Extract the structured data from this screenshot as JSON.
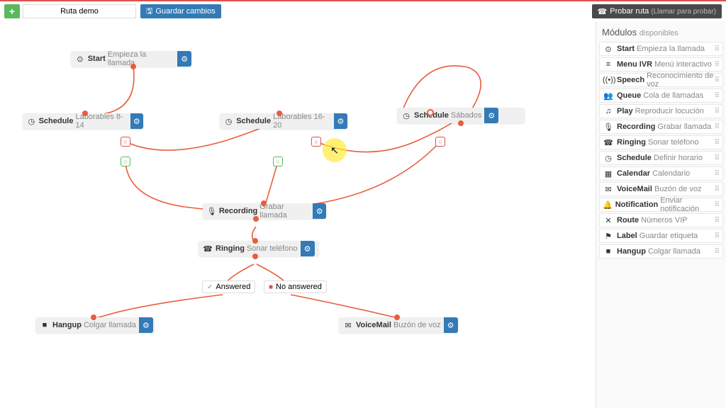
{
  "topbar": {
    "route_name": "Ruta demo",
    "save_label": "Guardar cambios",
    "test_label": "Probar ruta",
    "test_sub": "(Llamar para probar)"
  },
  "sidebar": {
    "title": "Módulos",
    "title_sub": "disponibles",
    "modules": [
      {
        "icon": "⊙",
        "name": "Start",
        "desc": "Empieza la llamada"
      },
      {
        "icon": "≡",
        "name": "Menu IVR",
        "desc": "Menú interactivo"
      },
      {
        "icon": "((•))",
        "name": "Speech",
        "desc": "Reconocimiento de voz"
      },
      {
        "icon": "👥",
        "name": "Queue",
        "desc": "Cola de llamadas"
      },
      {
        "icon": "♫",
        "name": "Play",
        "desc": "Reproducir locución"
      },
      {
        "icon": "🎙",
        "name": "Recording",
        "desc": "Grabar llamada"
      },
      {
        "icon": "☎",
        "name": "Ringing",
        "desc": "Sonar teléfono"
      },
      {
        "icon": "◷",
        "name": "Schedule",
        "desc": "Definir horario"
      },
      {
        "icon": "▦",
        "name": "Calendar",
        "desc": "Calendario"
      },
      {
        "icon": "✉",
        "name": "VoiceMail",
        "desc": "Buzón de voz"
      },
      {
        "icon": "🔔",
        "name": "Notification",
        "desc": "Enviar notificación"
      },
      {
        "icon": "✕",
        "name": "Route",
        "desc": "Números VIP"
      },
      {
        "icon": "⚑",
        "name": "Label",
        "desc": "Guardar etiqueta"
      },
      {
        "icon": "■",
        "name": "Hangup",
        "desc": "Colgar llamada"
      }
    ]
  },
  "nodes": {
    "start": {
      "title": "Start",
      "desc": "Empieza la llamada"
    },
    "sched1": {
      "title": "Schedule",
      "desc": "Laborables 8-14"
    },
    "sched2": {
      "title": "Schedule",
      "desc": "Laborables 16-20"
    },
    "sched3": {
      "title": "Schedule",
      "desc": "Sábados"
    },
    "recording": {
      "title": "Recording",
      "desc": "Grabar llamada"
    },
    "ringing": {
      "title": "Ringing",
      "desc": "Sonar teléfono"
    },
    "hangup": {
      "title": "Hangup",
      "desc": "Colgar llamada"
    },
    "voicemail": {
      "title": "VoiceMail",
      "desc": "Buzón de voz"
    }
  },
  "labels": {
    "answered": "Answered",
    "no_answered": "No answered"
  },
  "colors": {
    "wire": "#e85d3d",
    "primary": "#337ab7",
    "success": "#5cb85c",
    "danger": "#d9534f"
  }
}
